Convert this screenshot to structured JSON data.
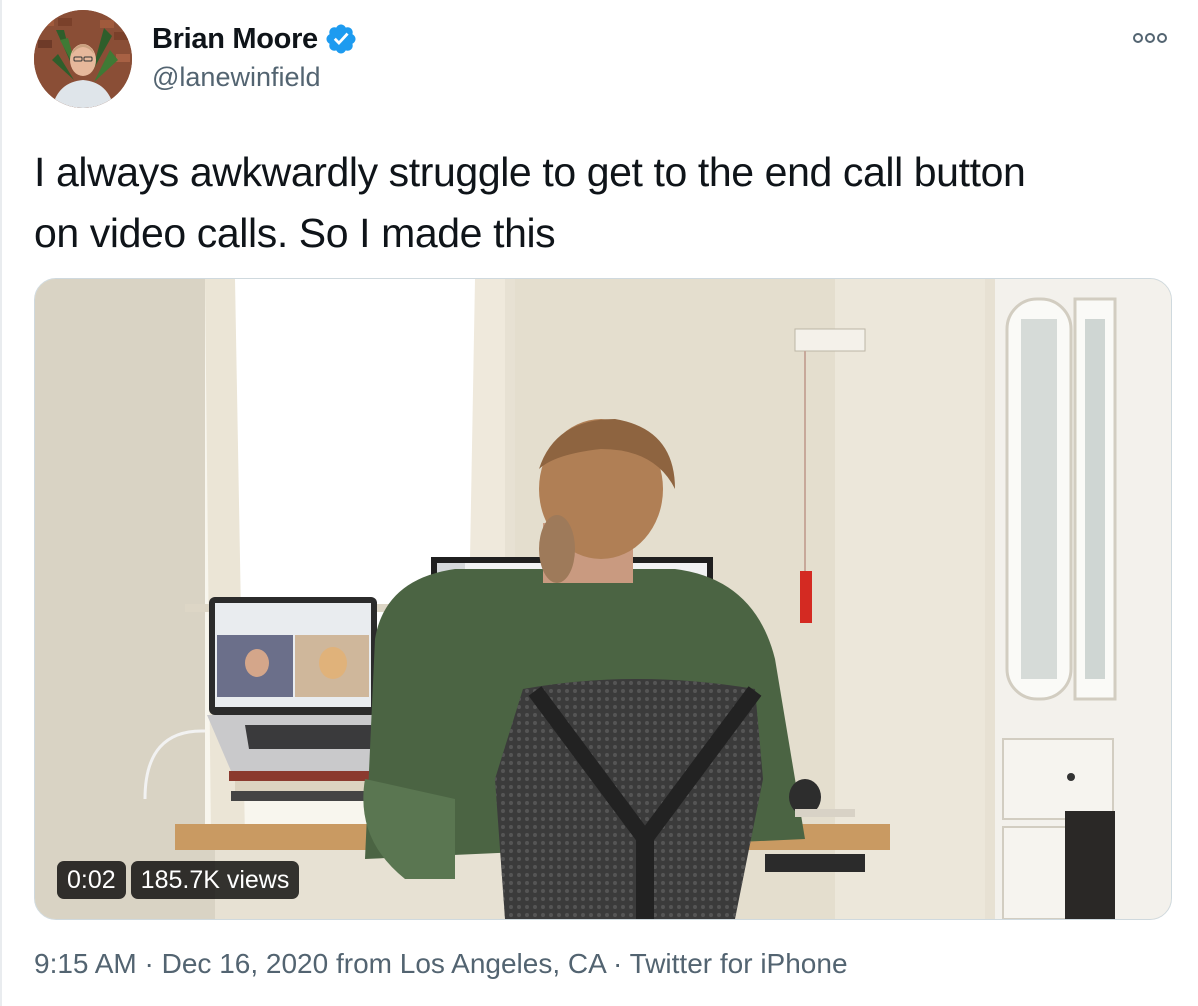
{
  "author": {
    "name": "Brian Moore",
    "handle": "@lanewinfield",
    "verified": true,
    "verified_icon": "verified-badge-icon",
    "avatar": "profile-photo"
  },
  "more_icon": "more-options-icon",
  "tweet": {
    "line1": "I always awkwardly struggle to get to the end call button",
    "line2": "on video calls. So I made this"
  },
  "video": {
    "duration": "0:02",
    "views": "185.7K views"
  },
  "meta": {
    "time": "9:15 AM",
    "sep1": " · ",
    "date": "Dec 16, 2020",
    "location": " from Los Angeles, CA",
    "sep2": " · ",
    "source": "Twitter for iPhone"
  },
  "colors": {
    "verified_blue": "#1d9bf0",
    "text_primary": "#0f1419",
    "text_secondary": "#536471"
  }
}
